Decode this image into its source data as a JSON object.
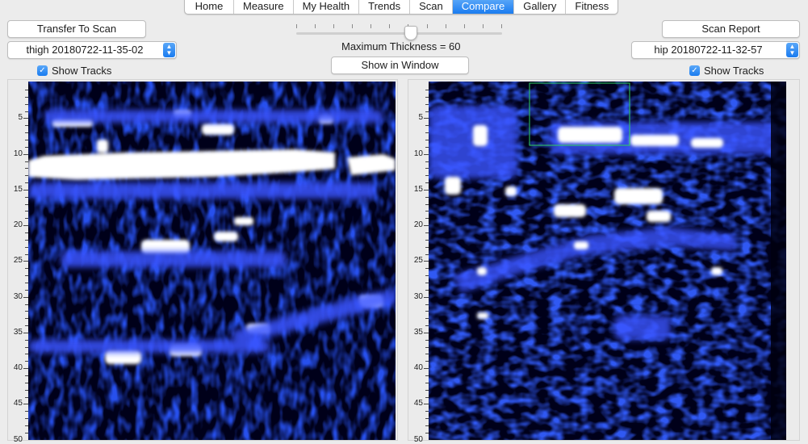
{
  "tabs": [
    {
      "label": "Home",
      "active": false
    },
    {
      "label": "Measure",
      "active": false
    },
    {
      "label": "My Health",
      "active": false
    },
    {
      "label": "Trends",
      "active": false
    },
    {
      "label": "Scan",
      "active": false
    },
    {
      "label": "Compare",
      "active": true
    },
    {
      "label": "Gallery",
      "active": false
    },
    {
      "label": "Fitness",
      "active": false
    }
  ],
  "left": {
    "transfer_button": "Transfer To Scan",
    "scan_select": "thigh 20180722-11-35-02",
    "show_tracks_label": "Show Tracks",
    "show_tracks_checked": true
  },
  "right": {
    "report_button": "Scan Report",
    "scan_select": "hip 20180722-11-32-57",
    "show_tracks_label": "Show Tracks",
    "show_tracks_checked": true
  },
  "center": {
    "thickness_label": "Maximum Thickness = 60",
    "thickness_value": 60,
    "show_window_button": "Show in Window"
  },
  "ruler_labels": [
    "5",
    "10",
    "15",
    "20",
    "25",
    "30",
    "35",
    "40",
    "45",
    "50"
  ],
  "colors": {
    "scan_background": "#00001a",
    "echo_blue": "#0a1eb4",
    "echo_bright": "#ffffff",
    "selection_box": "#30d060",
    "accent": "#1a7cf0"
  },
  "icons": {
    "popup_arrows": "updown-chevron-icon",
    "checkbox": "checkmark-icon"
  }
}
